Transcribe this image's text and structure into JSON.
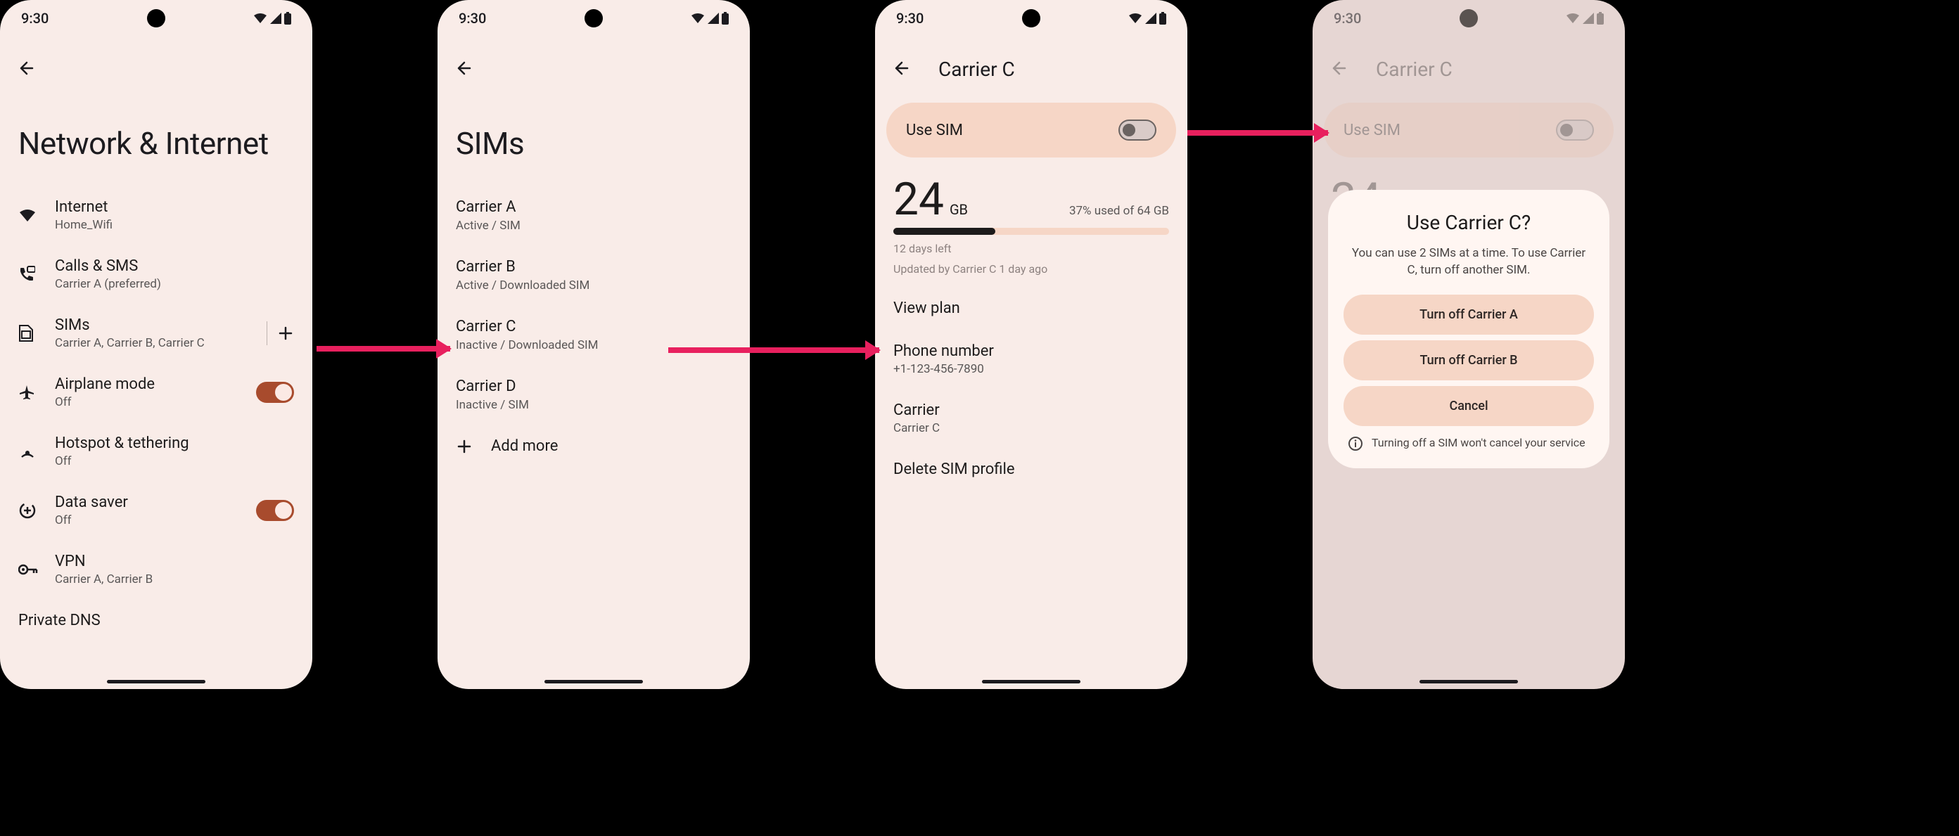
{
  "status": {
    "time": "9:30"
  },
  "screen1": {
    "title": "Network & Internet",
    "items": [
      {
        "title": "Internet",
        "sub": "Home_Wifi"
      },
      {
        "title": "Calls & SMS",
        "sub": "Carrier A (preferred)"
      },
      {
        "title": "SIMs",
        "sub": "Carrier A, Carrier B, Carrier C"
      },
      {
        "title": "Airplane mode",
        "sub": "Off",
        "toggle": true
      },
      {
        "title": "Hotspot & tethering",
        "sub": "Off"
      },
      {
        "title": "Data saver",
        "sub": "Off",
        "toggle": true
      },
      {
        "title": "VPN",
        "sub": "Carrier A, Carrier B"
      }
    ],
    "last": "Private DNS"
  },
  "screen2": {
    "title": "SIMs",
    "sims": [
      {
        "name": "Carrier A",
        "sub": "Active / SIM"
      },
      {
        "name": "Carrier B",
        "sub": "Active / Downloaded SIM"
      },
      {
        "name": "Carrier C",
        "sub": "Inactive / Downloaded SIM"
      },
      {
        "name": "Carrier D",
        "sub": "Inactive / SIM"
      }
    ],
    "add": "Add more"
  },
  "screen3": {
    "title": "Carrier C",
    "use_sim": "Use SIM",
    "data": {
      "amount": "24",
      "unit": "GB",
      "pct": "37% used of 64 GB",
      "days": "12 days left",
      "updated": "Updated by Carrier C 1 day ago",
      "fill_pct": 37
    },
    "settings": {
      "view_plan": "View plan",
      "phone_label": "Phone number",
      "phone_value": "+1-123-456-7890",
      "carrier_label": "Carrier",
      "carrier_value": "Carrier C",
      "delete": "Delete SIM profile"
    }
  },
  "screen4": {
    "dialog": {
      "title": "Use Carrier C?",
      "msg": "You can use 2 SIMs at a time. To use Carrier C, turn off another SIM.",
      "btn_a": "Turn off Carrier A",
      "btn_b": "Turn off Carrier B",
      "btn_cancel": "Cancel",
      "note": "Turning off a SIM won't cancel your service"
    }
  }
}
